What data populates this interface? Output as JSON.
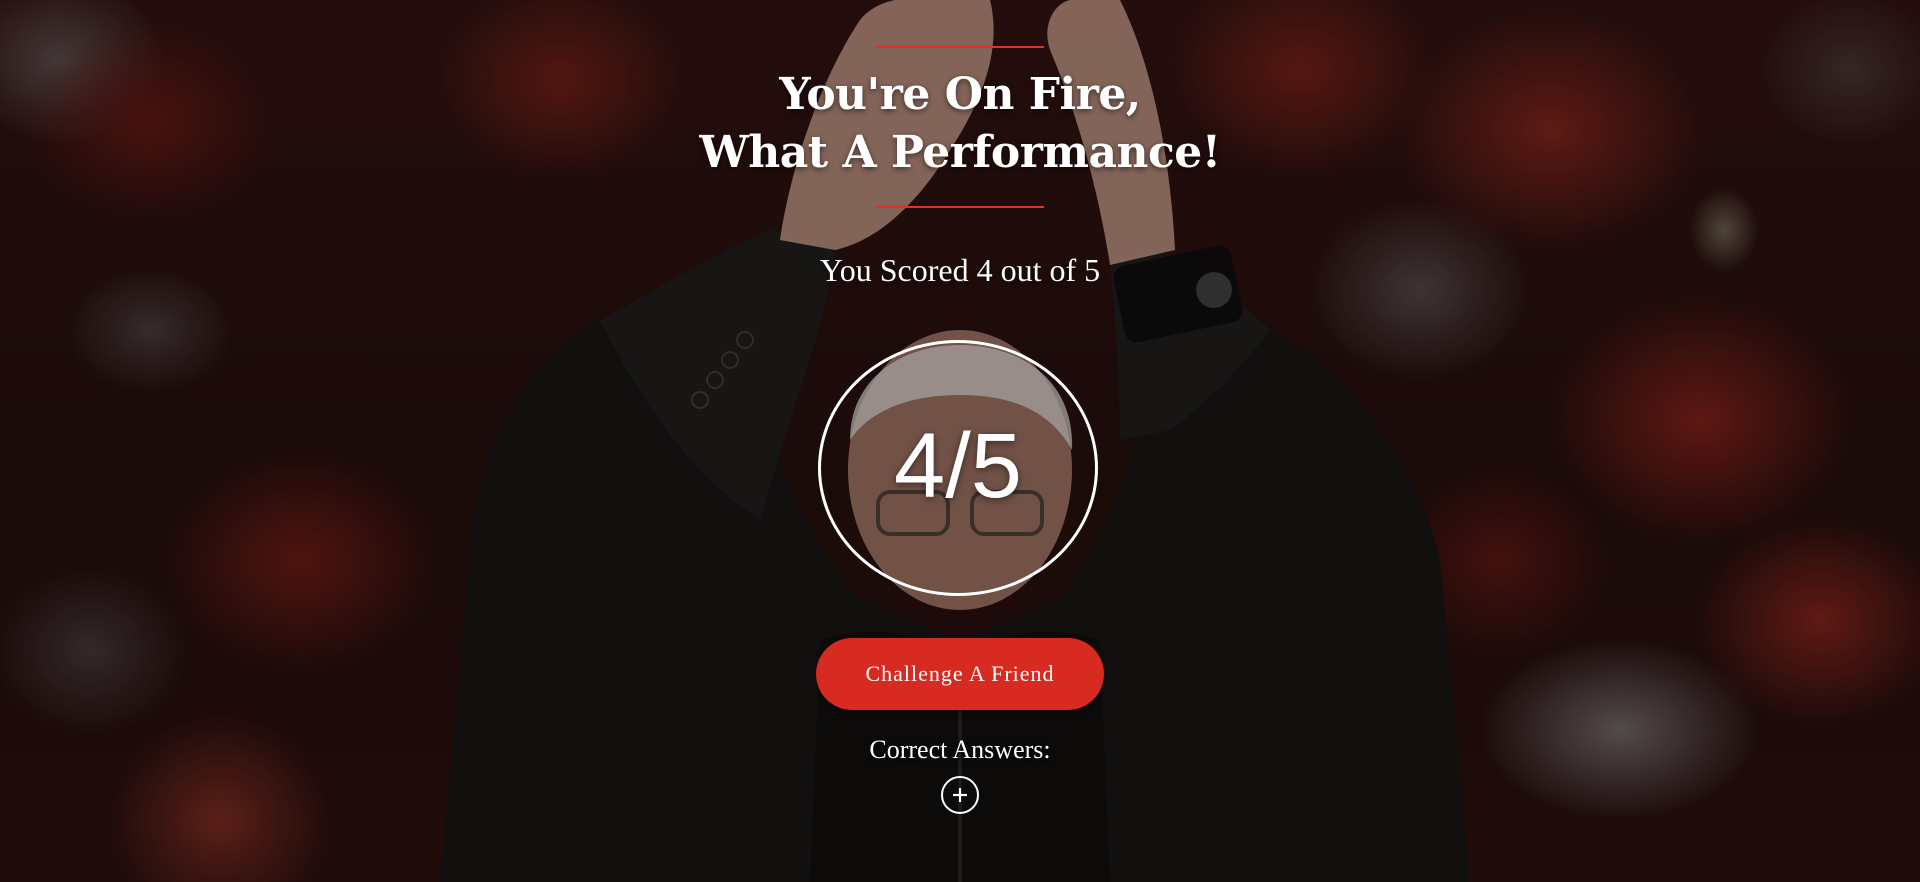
{
  "result": {
    "headline_line1": "You're On Fire,",
    "headline_line2": "What A Performance!",
    "score_text": "You Scored 4 out of 5",
    "score_badge": "4/5",
    "score": {
      "correct": 4,
      "total": 5
    }
  },
  "actions": {
    "challenge_label": "Challenge A Friend"
  },
  "answers": {
    "label": "Correct Answers:",
    "toggle_icon": "plus-circle-icon"
  },
  "colors": {
    "accent": "#d72a20",
    "rule": "#e0312a",
    "text": "#ffffff"
  }
}
